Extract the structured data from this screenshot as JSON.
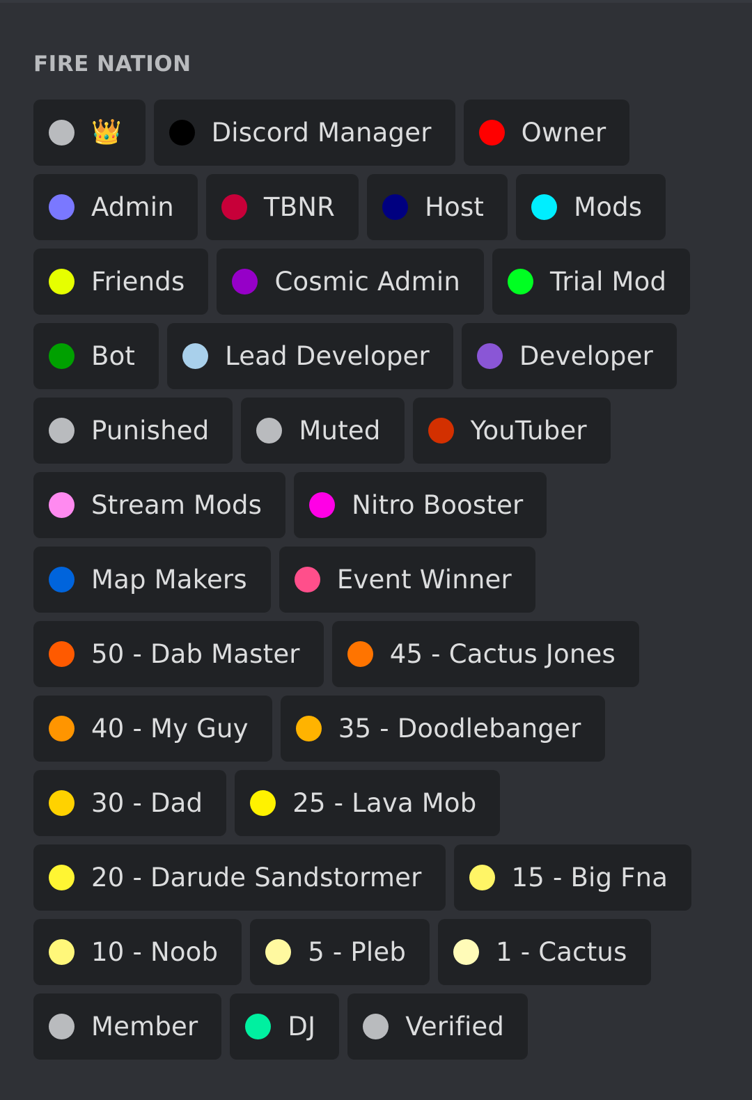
{
  "section": {
    "title": "FIRE NATION"
  },
  "rows": [
    [
      {
        "label": "",
        "icon": "crown-icon",
        "emoji": "👑",
        "color": "#b9bbbe"
      },
      {
        "label": "Discord Manager",
        "color": "#000000"
      },
      {
        "label": "Owner",
        "color": "#ff0000"
      }
    ],
    [
      {
        "label": "Admin",
        "color": "#7a78ff"
      },
      {
        "label": "TBNR",
        "color": "#c70039"
      },
      {
        "label": "Host",
        "color": "#000080"
      },
      {
        "label": "Mods",
        "color": "#00eeff"
      }
    ],
    [
      {
        "label": "Friends",
        "color": "#e6ff00"
      },
      {
        "label": "Cosmic Admin",
        "color": "#9600c8"
      },
      {
        "label": "Trial Mod",
        "color": "#00ff22"
      }
    ],
    [
      {
        "label": "Bot",
        "color": "#00a000"
      },
      {
        "label": "Lead Developer",
        "color": "#a9d0eb"
      },
      {
        "label": "Developer",
        "color": "#8a56d6"
      }
    ],
    [
      {
        "label": "Punished",
        "color": "#b9bbbe"
      },
      {
        "label": "Muted",
        "color": "#b9bbbe"
      },
      {
        "label": "YouTuber",
        "color": "#d33000"
      }
    ],
    [
      {
        "label": "Stream Mods",
        "color": "#ff8af0"
      },
      {
        "label": "Nitro Booster",
        "color": "#ff00e6"
      }
    ],
    [
      {
        "label": "Map Makers",
        "color": "#0064dc"
      },
      {
        "label": "Event Winner",
        "color": "#ff4f8b"
      }
    ],
    [
      {
        "label": "50 - Dab Master",
        "color": "#ff5a00"
      },
      {
        "label": "45 - Cactus Jones",
        "color": "#ff7400"
      }
    ],
    [
      {
        "label": "40 - My Guy",
        "color": "#ff9500"
      },
      {
        "label": "35 - Doodlebanger",
        "color": "#ffb300"
      }
    ],
    [
      {
        "label": "30 - Dad",
        "color": "#ffd200"
      },
      {
        "label": "25 - Lava Mob",
        "color": "#fff200"
      }
    ],
    [
      {
        "label": "20 - Darude Sandstormer",
        "color": "#fff533"
      },
      {
        "label": "15 - Big Fna",
        "color": "#fff566"
      }
    ],
    [
      {
        "label": "10 - Noob",
        "color": "#fff77a"
      },
      {
        "label": "5 - Pleb",
        "color": "#fff9a0"
      },
      {
        "label": "1 - Cactus",
        "color": "#fffbb8"
      }
    ],
    [
      {
        "label": "Member",
        "color": "#b9bbbe"
      },
      {
        "label": "DJ",
        "color": "#00f0a0"
      },
      {
        "label": "Verified",
        "color": "#b9bbbe"
      }
    ]
  ]
}
